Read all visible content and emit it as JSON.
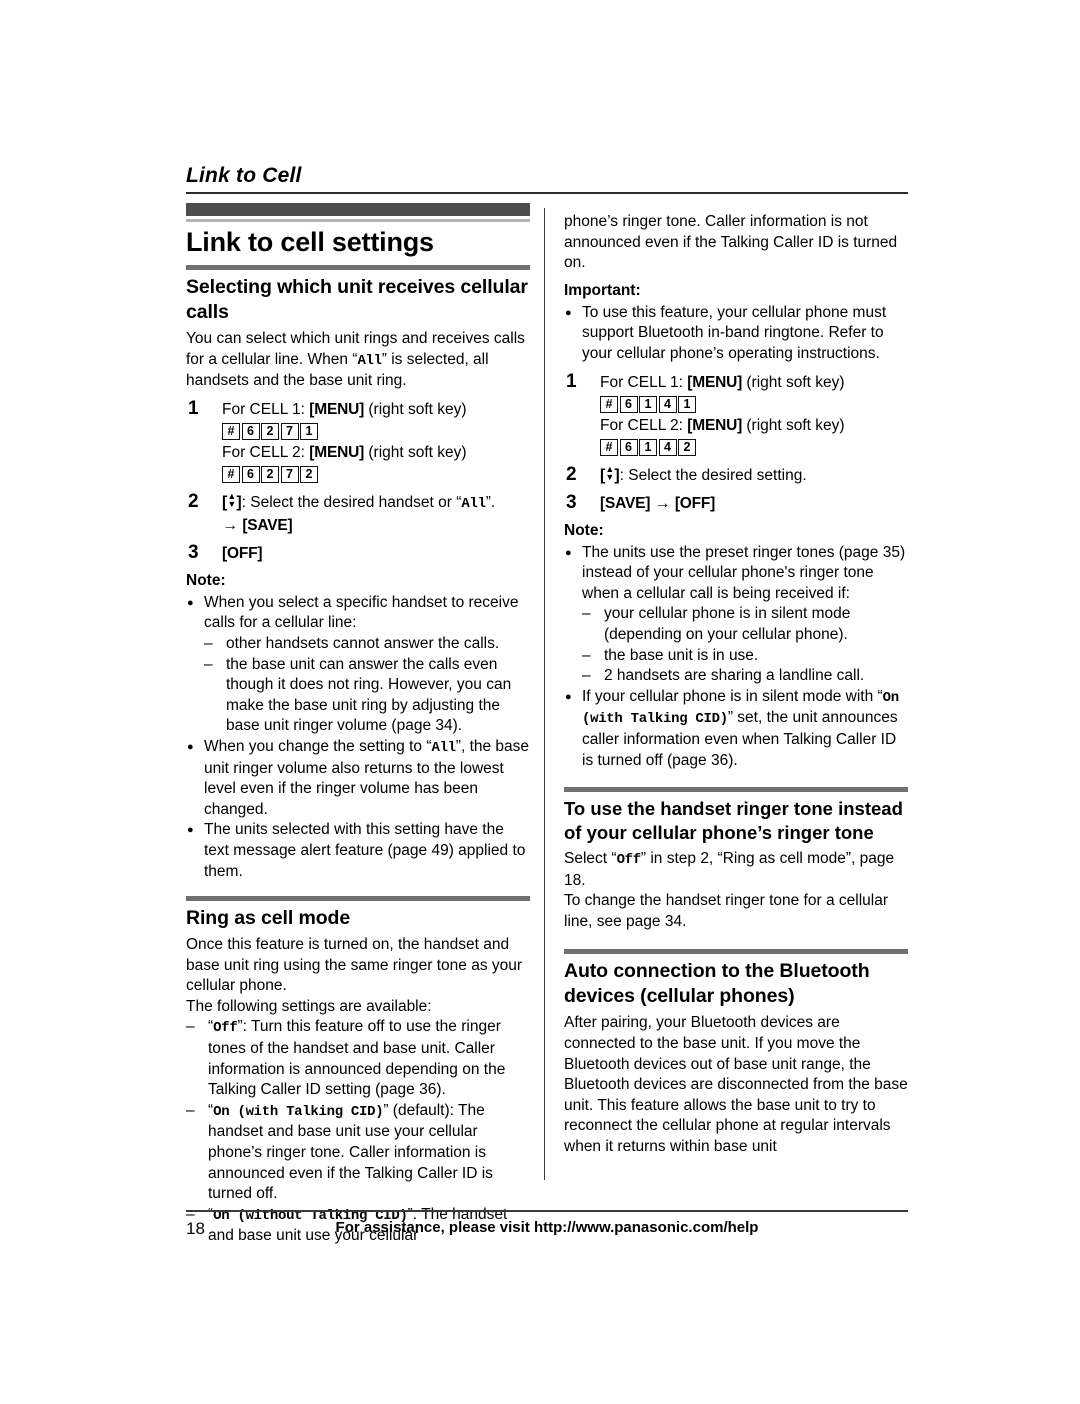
{
  "running_head": "Link to Cell",
  "page_title": "Link to cell settings",
  "left_column": {
    "section1": {
      "heading": "Selecting which unit receives cellular calls",
      "intro_1": "You can select which unit rings and receives calls for a cellular line. When “",
      "intro_mono": "All",
      "intro_2": "” is selected, all handsets and the base unit ring.",
      "steps": [
        {
          "num": "1",
          "line1_a": "For CELL 1: ",
          "line1_key": "[MENU]",
          "line1_b": " (right soft key)",
          "keys1": [
            "#",
            "6",
            "2",
            "7",
            "1"
          ],
          "line2_a": "For CELL 2: ",
          "line2_key": "[MENU]",
          "line2_b": " (right soft key)",
          "keys2": [
            "#",
            "6",
            "2",
            "7",
            "2"
          ]
        },
        {
          "num": "2",
          "text_a": ": Select the desired handset or “",
          "text_mono": "All",
          "text_b": "”.",
          "save_arrow": "→",
          "save_key": "[SAVE]"
        },
        {
          "num": "3",
          "off_key": "[OFF]"
        }
      ],
      "note_label": "Note:",
      "notes": [
        {
          "text": "When you select a specific handset to receive calls for a cellular line:",
          "sub": [
            "other handsets cannot answer the calls.",
            "the base unit can answer the calls even though it does not ring. However, you can make the base unit ring by adjusting the base unit ringer volume (page 34)."
          ]
        },
        {
          "text_a": "When you change the setting to “",
          "text_mono": "All",
          "text_b": "”, the base unit ringer volume also returns to the lowest level even if the ringer volume has been changed."
        },
        {
          "text": "The units selected with this setting have the text message alert feature (page 49) applied to them."
        }
      ]
    },
    "section2": {
      "heading": "Ring as cell mode",
      "para1": "Once this feature is turned on, the handset and base unit ring using the same ringer tone as your cellular phone.",
      "para2": "The following settings are available:",
      "options": [
        {
          "quote_open": "“",
          "mono": "Off",
          "quote_close": "”",
          "rest": ": Turn this feature off to use the ringer tones of the handset and base unit. Caller information is announced depending on the Talking Caller ID setting (page 36)."
        },
        {
          "quote_open": "“",
          "mono": "On (with Talking CID)",
          "quote_close": "”",
          "rest": " (default): The handset and base unit use your cellular phone’s ringer tone. Caller information is announced even if the Talking Caller ID is turned off."
        },
        {
          "quote_open": "“",
          "mono": "On (without Talking CID)",
          "quote_close": "”",
          "rest": ": The handset and base unit use your cellular"
        }
      ]
    }
  },
  "right_column": {
    "continued_para": "phone’s ringer tone. Caller information is not announced even if the Talking Caller ID is turned on.",
    "important_label": "Important:",
    "important_notes": [
      "To use this feature, your cellular phone must support Bluetooth in-band ringtone. Refer to your cellular phone’s operating instructions."
    ],
    "steps": [
      {
        "num": "1",
        "line1_a": "For CELL 1: ",
        "line1_key": "[MENU]",
        "line1_b": " (right soft key)",
        "keys1": [
          "#",
          "6",
          "1",
          "4",
          "1"
        ],
        "line2_a": "For CELL 2: ",
        "line2_key": "[MENU]",
        "line2_b": " (right soft key)",
        "keys2": [
          "#",
          "6",
          "1",
          "4",
          "2"
        ]
      },
      {
        "num": "2",
        "text": ": Select the desired setting."
      },
      {
        "num": "3",
        "save_key": "[SAVE]",
        "arrow": "→",
        "off_key": "[OFF]"
      }
    ],
    "note_label": "Note:",
    "notes": [
      {
        "text": "The units use the preset ringer tones (page 35) instead of your cellular phone's ringer tone when a cellular call is being received if:",
        "sub": [
          "your cellular phone is in silent mode (depending on your cellular phone).",
          "the base unit is in use.",
          "2 handsets are sharing a landline call."
        ]
      },
      {
        "text_a": "If your cellular phone is in silent mode with “",
        "text_mono": "On (with Talking CID)",
        "text_b": "” set, the unit announces caller information even when Talking Caller ID is turned off (page 36)."
      }
    ],
    "section_ringer": {
      "heading": "To use the handset ringer tone instead of your cellular phone’s ringer tone",
      "para1_a": "Select “",
      "para1_mono": "Off",
      "para1_b": "” in step 2, “Ring as cell mode”, page 18.",
      "para2": "To change the handset ringer tone for a cellular line, see page 34."
    },
    "section_auto": {
      "heading": "Auto connection to the Bluetooth devices (cellular phones)",
      "para1": "After pairing, your Bluetooth devices are connected to the base unit. If you move the Bluetooth devices out of base unit range, the Bluetooth devices are disconnected from the base unit. This feature allows the base unit to try to reconnect the cellular phone at regular intervals when it returns within base unit"
    }
  },
  "footer": {
    "page_number": "18",
    "assistance_text": "For assistance, please visit http://www.panasonic.com/help"
  }
}
